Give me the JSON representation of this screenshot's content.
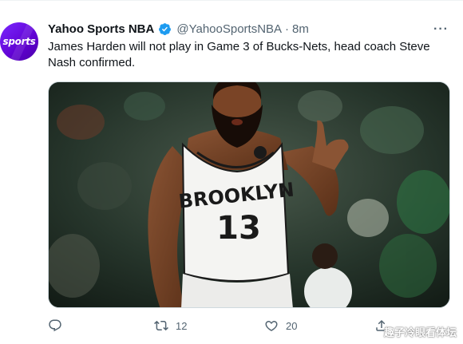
{
  "tweet": {
    "avatar_text": "sports",
    "display_name": "Yahoo Sports NBA",
    "handle": "@YahooSportsNBA",
    "separator": "·",
    "time": "8m",
    "more_label": "···",
    "text": "James Harden will not play in Game 3 of Bucks-Nets, head coach Steve Nash confirmed."
  },
  "media": {
    "jersey_team": "BROOKLYN",
    "jersey_number": "13"
  },
  "actions": {
    "retweet_count": "12",
    "like_count": "20"
  },
  "watermark": "趣子冷眼看体坛",
  "colors": {
    "brand_avatar": "#6001d2",
    "verified": "#1d9bf0",
    "secondary_text": "#536471"
  }
}
